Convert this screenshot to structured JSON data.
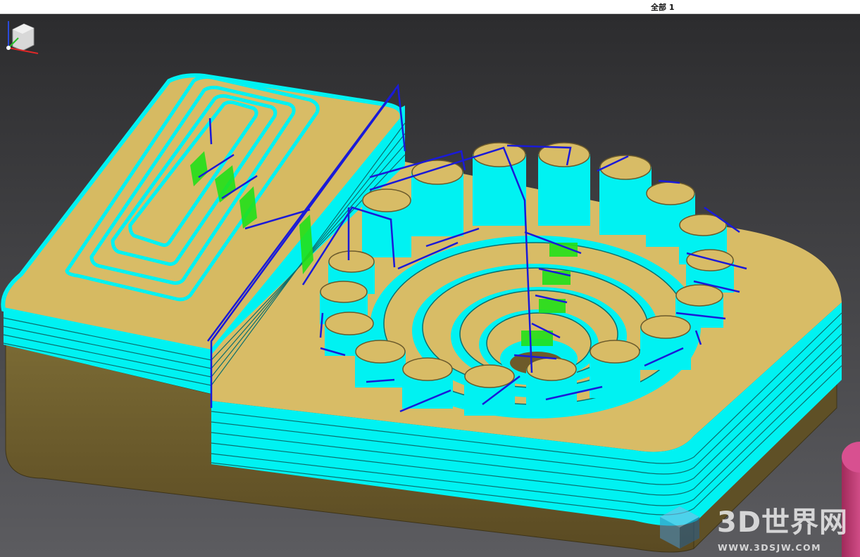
{
  "header": {
    "label": "全部 1"
  },
  "watermark": {
    "title": "3D世界网",
    "url": "WWW.3DSJW.COM",
    "logo": "cube-logo-icon"
  },
  "colors": {
    "background_top": "#2c2c2e",
    "background_bottom": "#5a5a5e",
    "part_top": "#dcc06a",
    "part_side": "#6b5a2c",
    "toolpath_cutting": "#00f2f2",
    "toolpath_link": "#1a1ad8",
    "toolpath_plunge": "#22e01a",
    "fixture": "#c8407a"
  },
  "triad": {
    "icon": "view-orientation-triad-icon"
  }
}
